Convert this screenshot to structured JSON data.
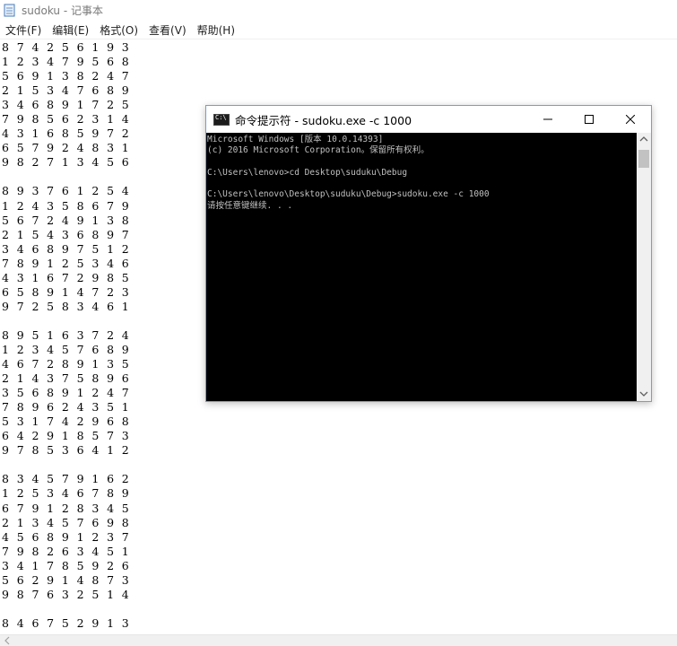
{
  "notepad": {
    "title": "sudoku - 记事本",
    "menu": [
      "文件(F)",
      "编辑(E)",
      "格式(O)",
      "查看(V)",
      "帮助(H)"
    ],
    "lines": [
      "8 7 4 2 5 6 1 9 3",
      "1 2 3 4 7 9 5 6 8",
      "5 6 9 1 3 8 2 4 7",
      "2 1 5 3 4 7 6 8 9",
      "3 4 6 8 9 1 7 2 5",
      "7 9 8 5 6 2 3 1 4",
      "4 3 1 6 8 5 9 7 2",
      "6 5 7 9 2 4 8 3 1",
      "9 8 2 7 1 3 4 5 6",
      "",
      "8 9 3 7 6 1 2 5 4",
      "1 2 4 3 5 8 6 7 9",
      "5 6 7 2 4 9 1 3 8",
      "2 1 5 4 3 6 8 9 7",
      "3 4 6 8 9 7 5 1 2",
      "7 8 9 1 2 5 3 4 6",
      "4 3 1 6 7 2 9 8 5",
      "6 5 8 9 1 4 7 2 3",
      "9 7 2 5 8 3 4 6 1",
      "",
      "8 9 5 1 6 3 7 2 4",
      "1 2 3 4 5 7 6 8 9",
      "4 6 7 2 8 9 1 3 5",
      "2 1 4 3 7 5 8 9 6",
      "3 5 6 8 9 1 2 4 7",
      "7 8 9 6 2 4 3 5 1",
      "5 3 1 7 4 2 9 6 8",
      "6 4 2 9 1 8 5 7 3",
      "9 7 8 5 3 6 4 1 2",
      "",
      "8 3 4 5 7 9 1 6 2",
      "1 2 5 3 4 6 7 8 9",
      "6 7 9 1 2 8 3 4 5",
      "2 1 3 4 5 7 6 9 8",
      "4 5 6 8 9 1 2 3 7",
      "7 9 8 2 6 3 4 5 1",
      "3 4 1 7 8 5 9 2 6",
      "5 6 2 9 1 4 8 7 3",
      "9 8 7 6 3 2 5 1 4",
      "",
      "8 4 6 7 5 2 9 1 3"
    ]
  },
  "console": {
    "title": "命令提示符 - sudoku.exe  -c 1000",
    "icon_label": "C:\\",
    "lines": [
      "Microsoft Windows [版本 10.0.14393]",
      "(c) 2016 Microsoft Corporation。保留所有权利。",
      "",
      "C:\\Users\\lenovo>cd Desktop\\suduku\\Debug",
      "",
      "C:\\Users\\lenovo\\Desktop\\suduku\\Debug>sudoku.exe -c 1000",
      "请按任意键继续. . ."
    ]
  },
  "icons": {
    "notepad": "notepad-icon",
    "minimize": "minimize-icon",
    "maximize": "maximize-icon",
    "close": "close-icon",
    "scroll_up": "chevron-up-icon",
    "scroll_down": "chevron-down-icon",
    "scroll_left": "chevron-left-icon"
  },
  "colors": {
    "console_bg": "#000000",
    "console_text": "#c0c0c0",
    "window_border": "#7a9cc8"
  }
}
